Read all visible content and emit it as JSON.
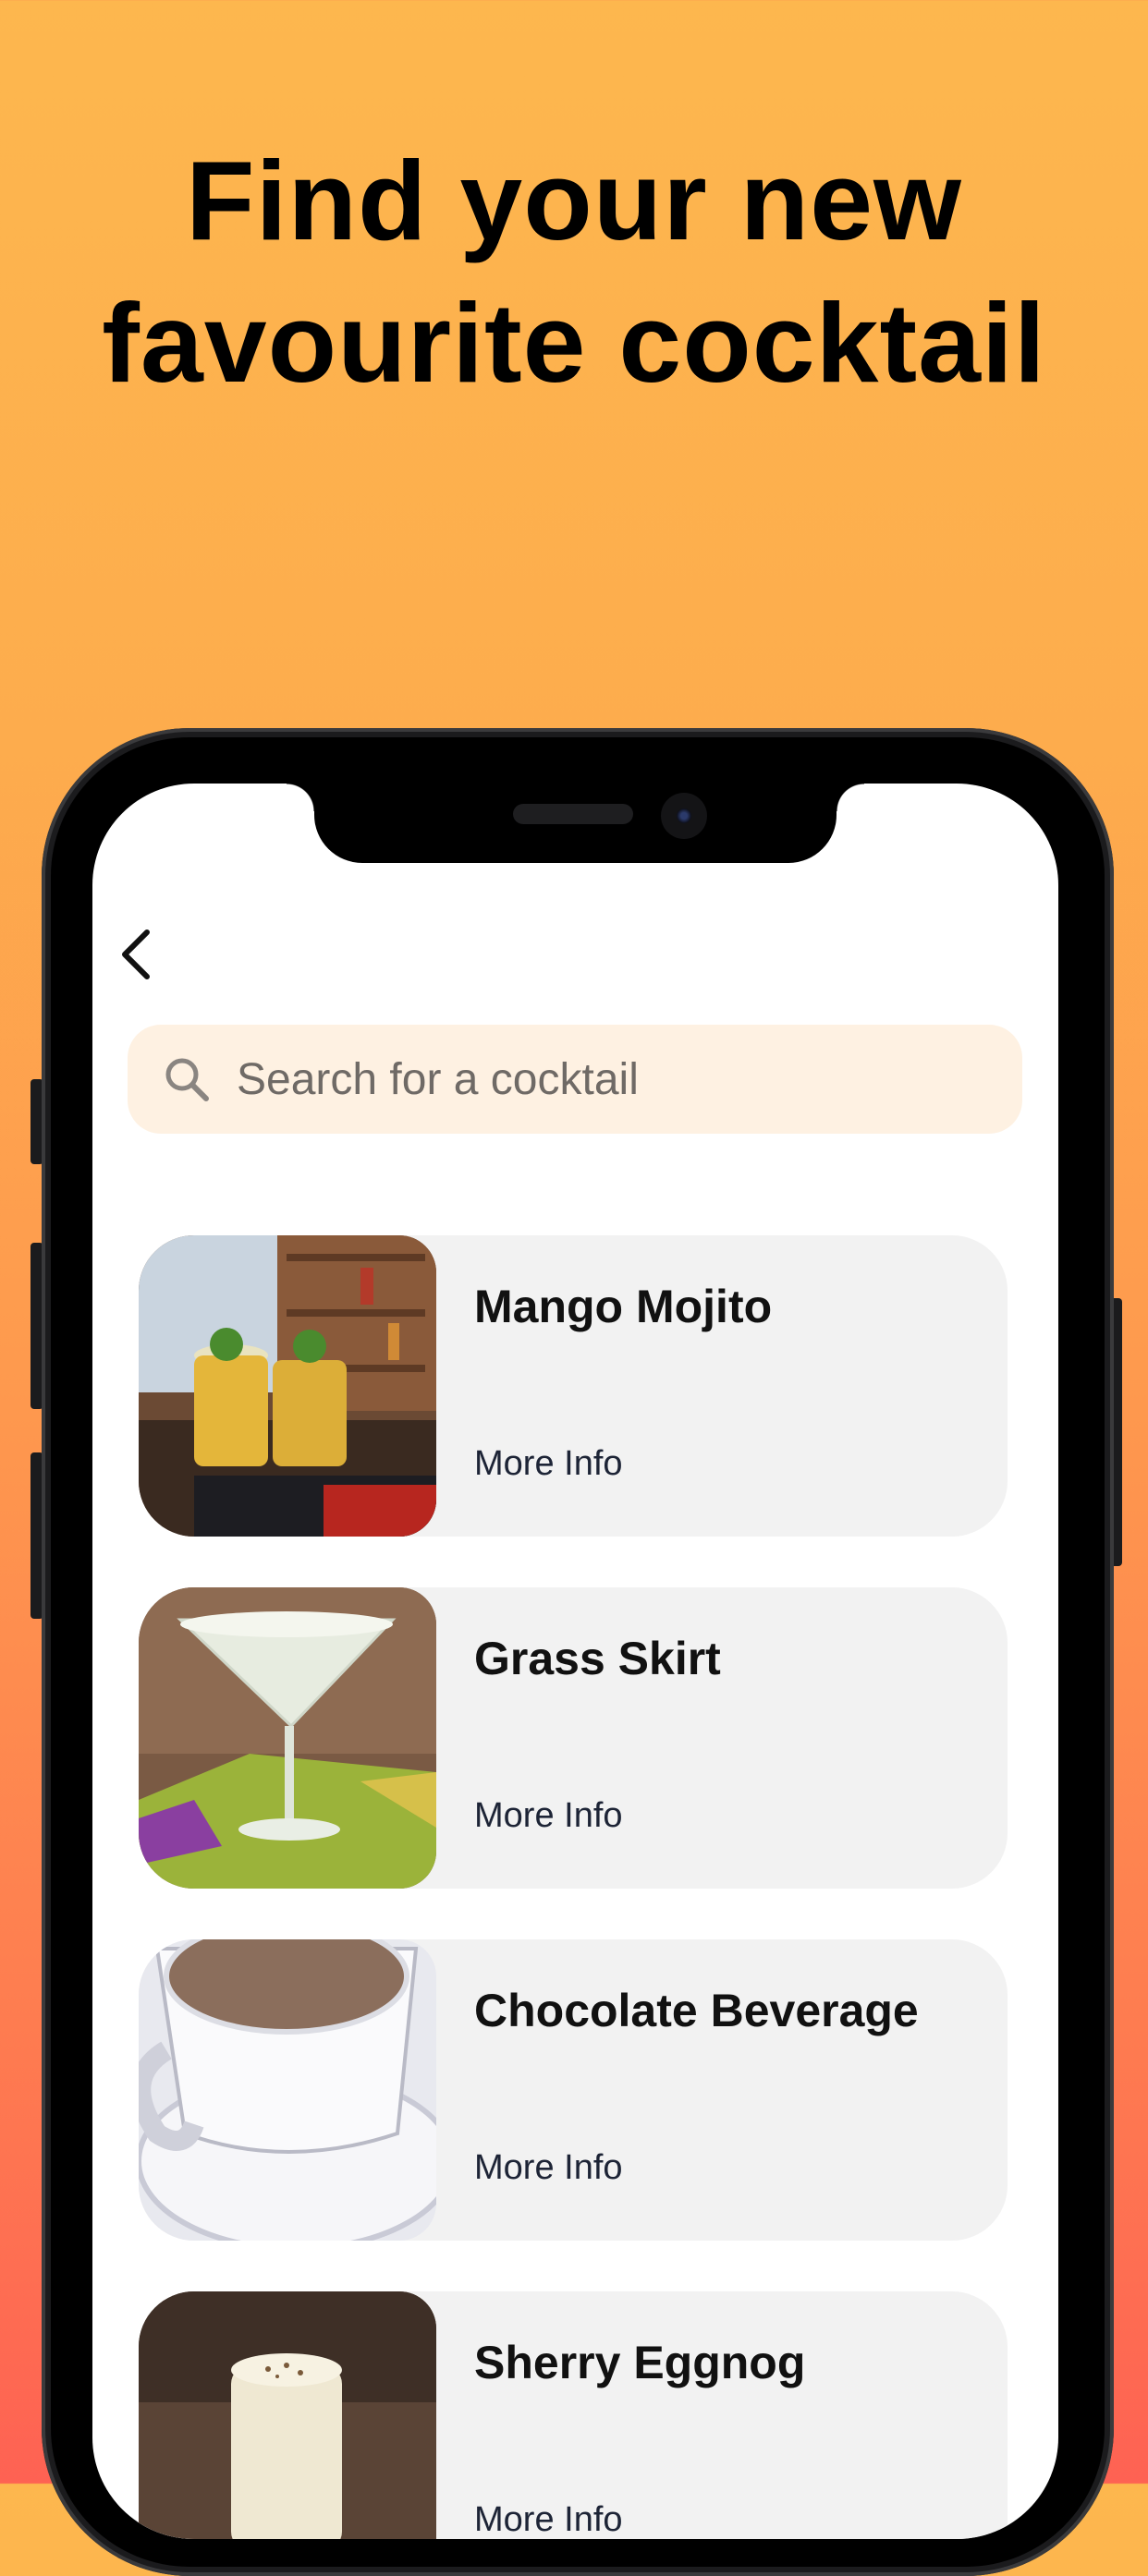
{
  "headline": {
    "line1": "Find your new",
    "line2": "favourite cocktail"
  },
  "nav": {
    "back_icon": "chevron-left-icon"
  },
  "search": {
    "icon": "search-icon",
    "placeholder": "Search for a cocktail",
    "value": ""
  },
  "cocktails": [
    {
      "name": "Mango Mojito",
      "more_label": "More Info"
    },
    {
      "name": "Grass Skirt",
      "more_label": "More Info"
    },
    {
      "name": "Chocolate Beverage",
      "more_label": "More Info"
    },
    {
      "name": "Sherry Eggnog",
      "more_label": "More Info"
    }
  ],
  "colors": {
    "background_top": "#FDB74E",
    "background_bottom": "#FE6253",
    "search_bg": "#FEF1E2",
    "card_bg": "#F2F2F2",
    "link_text": "#1d2436"
  }
}
